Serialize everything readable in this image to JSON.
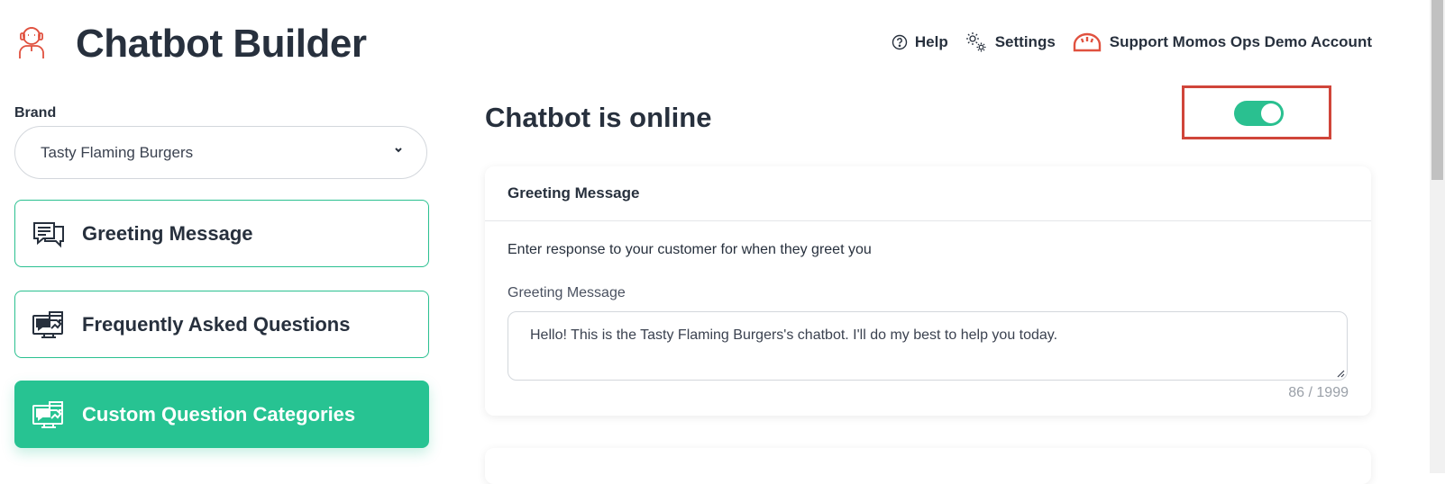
{
  "app": {
    "title": "Chatbot Builder"
  },
  "nav": {
    "help": "Help",
    "settings": "Settings",
    "account": "Support Momos Ops Demo Account"
  },
  "brand": {
    "label": "Brand",
    "selected": "Tasty Flaming Burgers"
  },
  "sidebar": {
    "items": [
      {
        "label": "Greeting Message",
        "icon": "chat-bubbles-icon",
        "active": false
      },
      {
        "label": "Frequently Asked Questions",
        "icon": "faq-monitor-icon",
        "active": false
      },
      {
        "label": "Custom Question Categories",
        "icon": "faq-monitor-icon",
        "active": true
      }
    ]
  },
  "status": {
    "title": "Chatbot is online",
    "online": true
  },
  "greeting_card": {
    "header": "Greeting Message",
    "description": "Enter response to your customer for when they greet you",
    "field_label": "Greeting Message",
    "value": "Hello! This is the Tasty Flaming Burgers's chatbot. I'll do my best to help you today.",
    "char_count": "86 / 1999"
  },
  "colors": {
    "accent": "#27c392",
    "highlight_border": "#d0453a",
    "text_dark": "#27303d"
  }
}
